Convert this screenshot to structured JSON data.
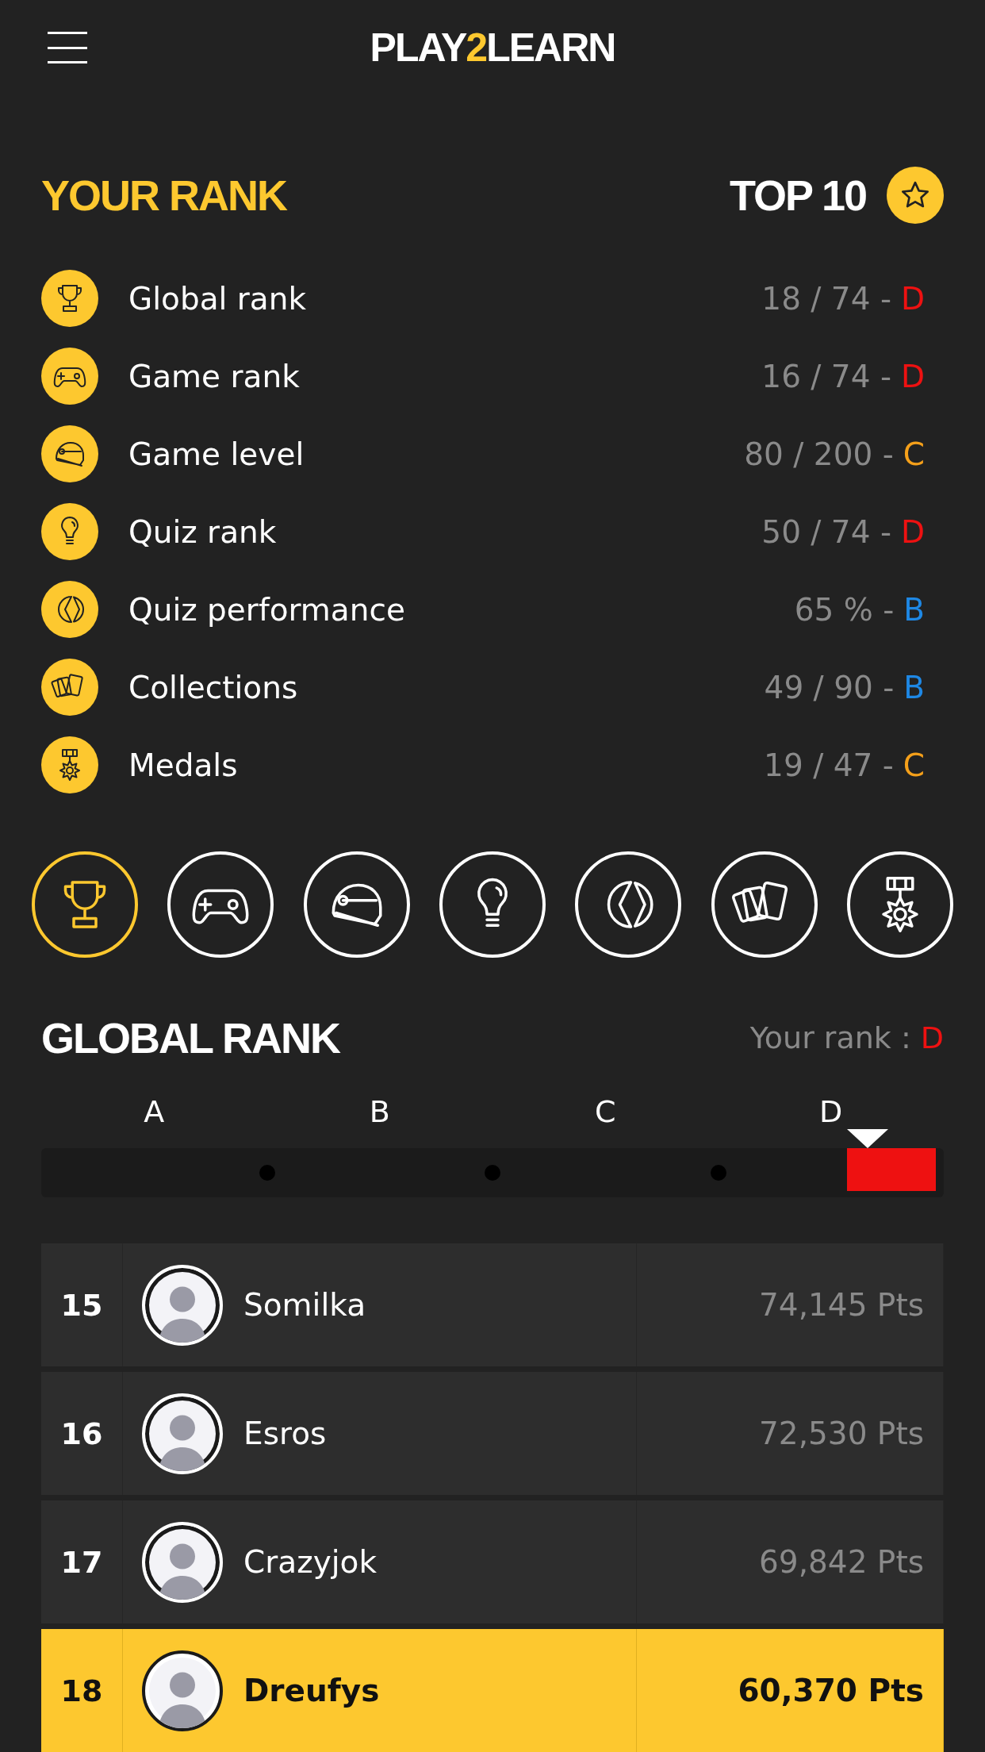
{
  "header": {
    "logo_start": "PLAY",
    "logo_mid": "2",
    "logo_end": "LEARN"
  },
  "your_rank": {
    "title": "YOUR RANK",
    "badge": "TOP 10"
  },
  "stats": [
    {
      "kind": "trophy",
      "label": "Global rank",
      "value": "18 / 74 -",
      "grade": "D",
      "color": "#ee1111"
    },
    {
      "kind": "gamepad",
      "label": "Game rank",
      "value": "16 / 74 -",
      "grade": "D",
      "color": "#ee1111"
    },
    {
      "kind": "helmet",
      "label": "Game level",
      "value": "80 / 200 -",
      "grade": "C",
      "color": "#f5a01a"
    },
    {
      "kind": "bulb",
      "label": "Quiz rank",
      "value": "50 / 74 -",
      "grade": "D",
      "color": "#ee1111"
    },
    {
      "kind": "pie",
      "label": "Quiz performance",
      "value": "65 % -",
      "grade": "B",
      "color": "#1e88e5"
    },
    {
      "kind": "cards",
      "label": "Collections",
      "value": "49 / 90 -",
      "grade": "B",
      "color": "#1e88e5"
    },
    {
      "kind": "medal",
      "label": "Medals",
      "value": "19 / 47 -",
      "grade": "C",
      "color": "#f5a01a"
    }
  ],
  "categories": [
    {
      "kind": "trophy",
      "selected": true
    },
    {
      "kind": "gamepad",
      "selected": false
    },
    {
      "kind": "helmet",
      "selected": false
    },
    {
      "kind": "bulb",
      "selected": false
    },
    {
      "kind": "pie",
      "selected": false
    },
    {
      "kind": "cards",
      "selected": false
    },
    {
      "kind": "medal",
      "selected": false
    }
  ],
  "section": {
    "title": "GLOBAL RANK",
    "your_rank_label": "Your rank :",
    "your_rank_grade": "D",
    "color": "#ee1111"
  },
  "scale": [
    {
      "label": "A",
      "selected": false
    },
    {
      "label": "B",
      "selected": false
    },
    {
      "label": "C",
      "selected": false
    },
    {
      "label": "D",
      "selected": true
    }
  ],
  "leaderboard": [
    {
      "rank": "15",
      "name": "Somilka",
      "points": "74,145 Pts",
      "highlighted": false
    },
    {
      "rank": "16",
      "name": "Esros",
      "points": "72,530 Pts",
      "highlighted": false
    },
    {
      "rank": "17",
      "name": "Crazyjok",
      "points": "69,842 Pts",
      "highlighted": false
    },
    {
      "rank": "18",
      "name": "Dreufys",
      "points": "60,370 Pts",
      "highlighted": true
    }
  ]
}
